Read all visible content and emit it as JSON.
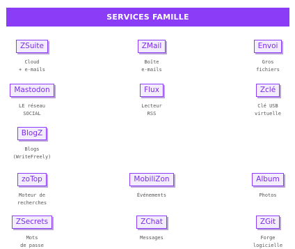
{
  "header": {
    "title": "SERVICES FAMILLE"
  },
  "services": {
    "zsuite": {
      "label": "ZSuite",
      "desc": [
        "Cloud",
        "+ e-mails"
      ]
    },
    "zmail": {
      "label": "ZMail",
      "desc": [
        "Boîte",
        "e-mails"
      ]
    },
    "envoi": {
      "label": "Envoi",
      "desc": [
        "Gros",
        "fichiers"
      ]
    },
    "mastodon": {
      "label": "Mastodon",
      "desc": [
        "LE réseau",
        "SOCIAL"
      ]
    },
    "flux": {
      "label": "Flux",
      "desc": [
        "Lecteur",
        "RSS"
      ]
    },
    "zcle": {
      "label": "Zclé",
      "desc": [
        "Clé USB",
        "virtuelle"
      ]
    },
    "blogz": {
      "label": "BlogZ",
      "desc": [
        "Blogs",
        "(WriteFreely)"
      ]
    },
    "zotop": {
      "label": "zoTop",
      "desc": [
        "Moteur de",
        "recherches"
      ]
    },
    "mobilizon": {
      "label": "MobiliZon",
      "desc": [
        "Événements"
      ]
    },
    "album": {
      "label": "Album",
      "desc": [
        "Photos"
      ]
    },
    "zsecrets": {
      "label": "ZSecrets",
      "desc": [
        "Mots",
        "de passe"
      ]
    },
    "zchat": {
      "label": "ZChat",
      "desc": [
        "Messages"
      ]
    },
    "zgit": {
      "label": "ZGit",
      "desc": [
        "Forge",
        "logicielle"
      ]
    }
  },
  "colors": {
    "accent": "#8b3cf7",
    "button_bg": "#f3ecff",
    "button_text": "#7a2de6",
    "shadow": "#b9a3d8"
  }
}
